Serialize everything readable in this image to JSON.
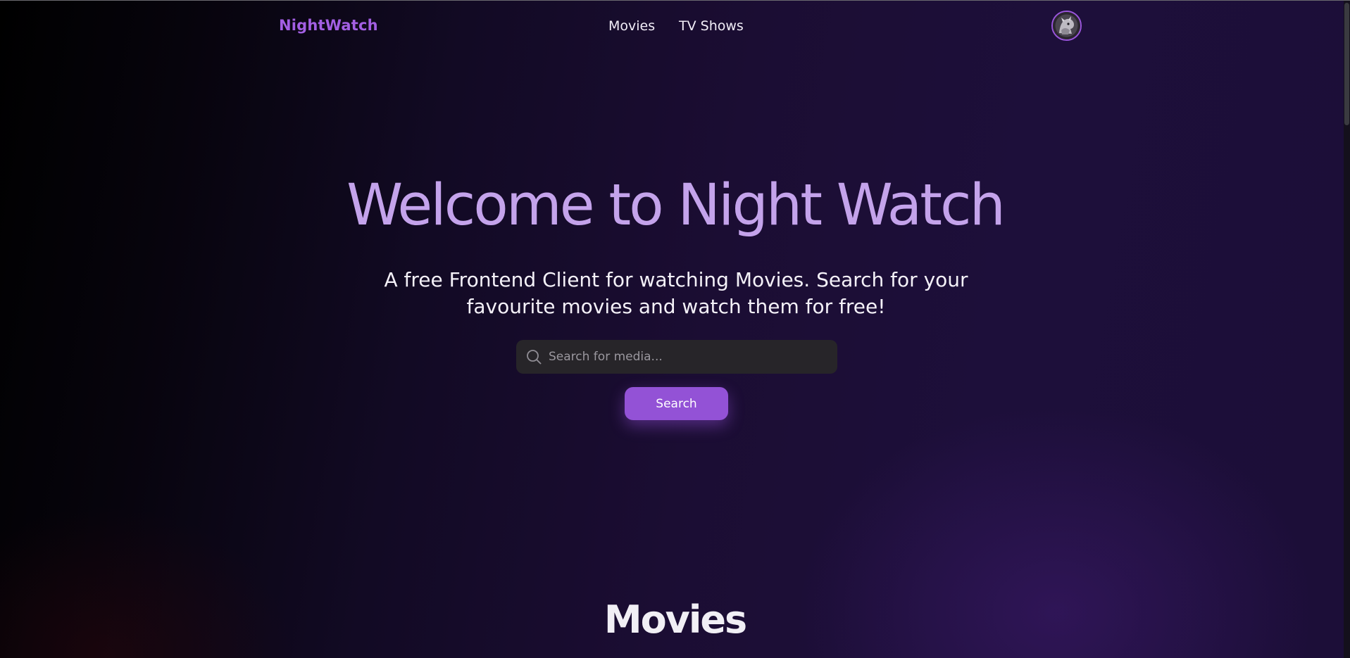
{
  "header": {
    "brand": "NightWatch",
    "nav": [
      {
        "label": "Movies"
      },
      {
        "label": "TV Shows"
      }
    ],
    "avatar_icon": "user-avatar"
  },
  "hero": {
    "title": "Welcome to Night Watch",
    "subtitle": "A free Frontend Client for watching Movies. Search for your favourite movies and watch them for free!"
  },
  "search": {
    "icon": "search-icon",
    "placeholder": "Search for media...",
    "value": "",
    "button_label": "Search"
  },
  "sections": [
    {
      "title": "Movies"
    }
  ],
  "colors": {
    "accent": "#9352d6",
    "brand": "#a35fe3",
    "hero_title": "#c4a3eb",
    "background_dark": "#000000",
    "background_purple": "#1d0f3a",
    "search_bg": "#272529"
  }
}
